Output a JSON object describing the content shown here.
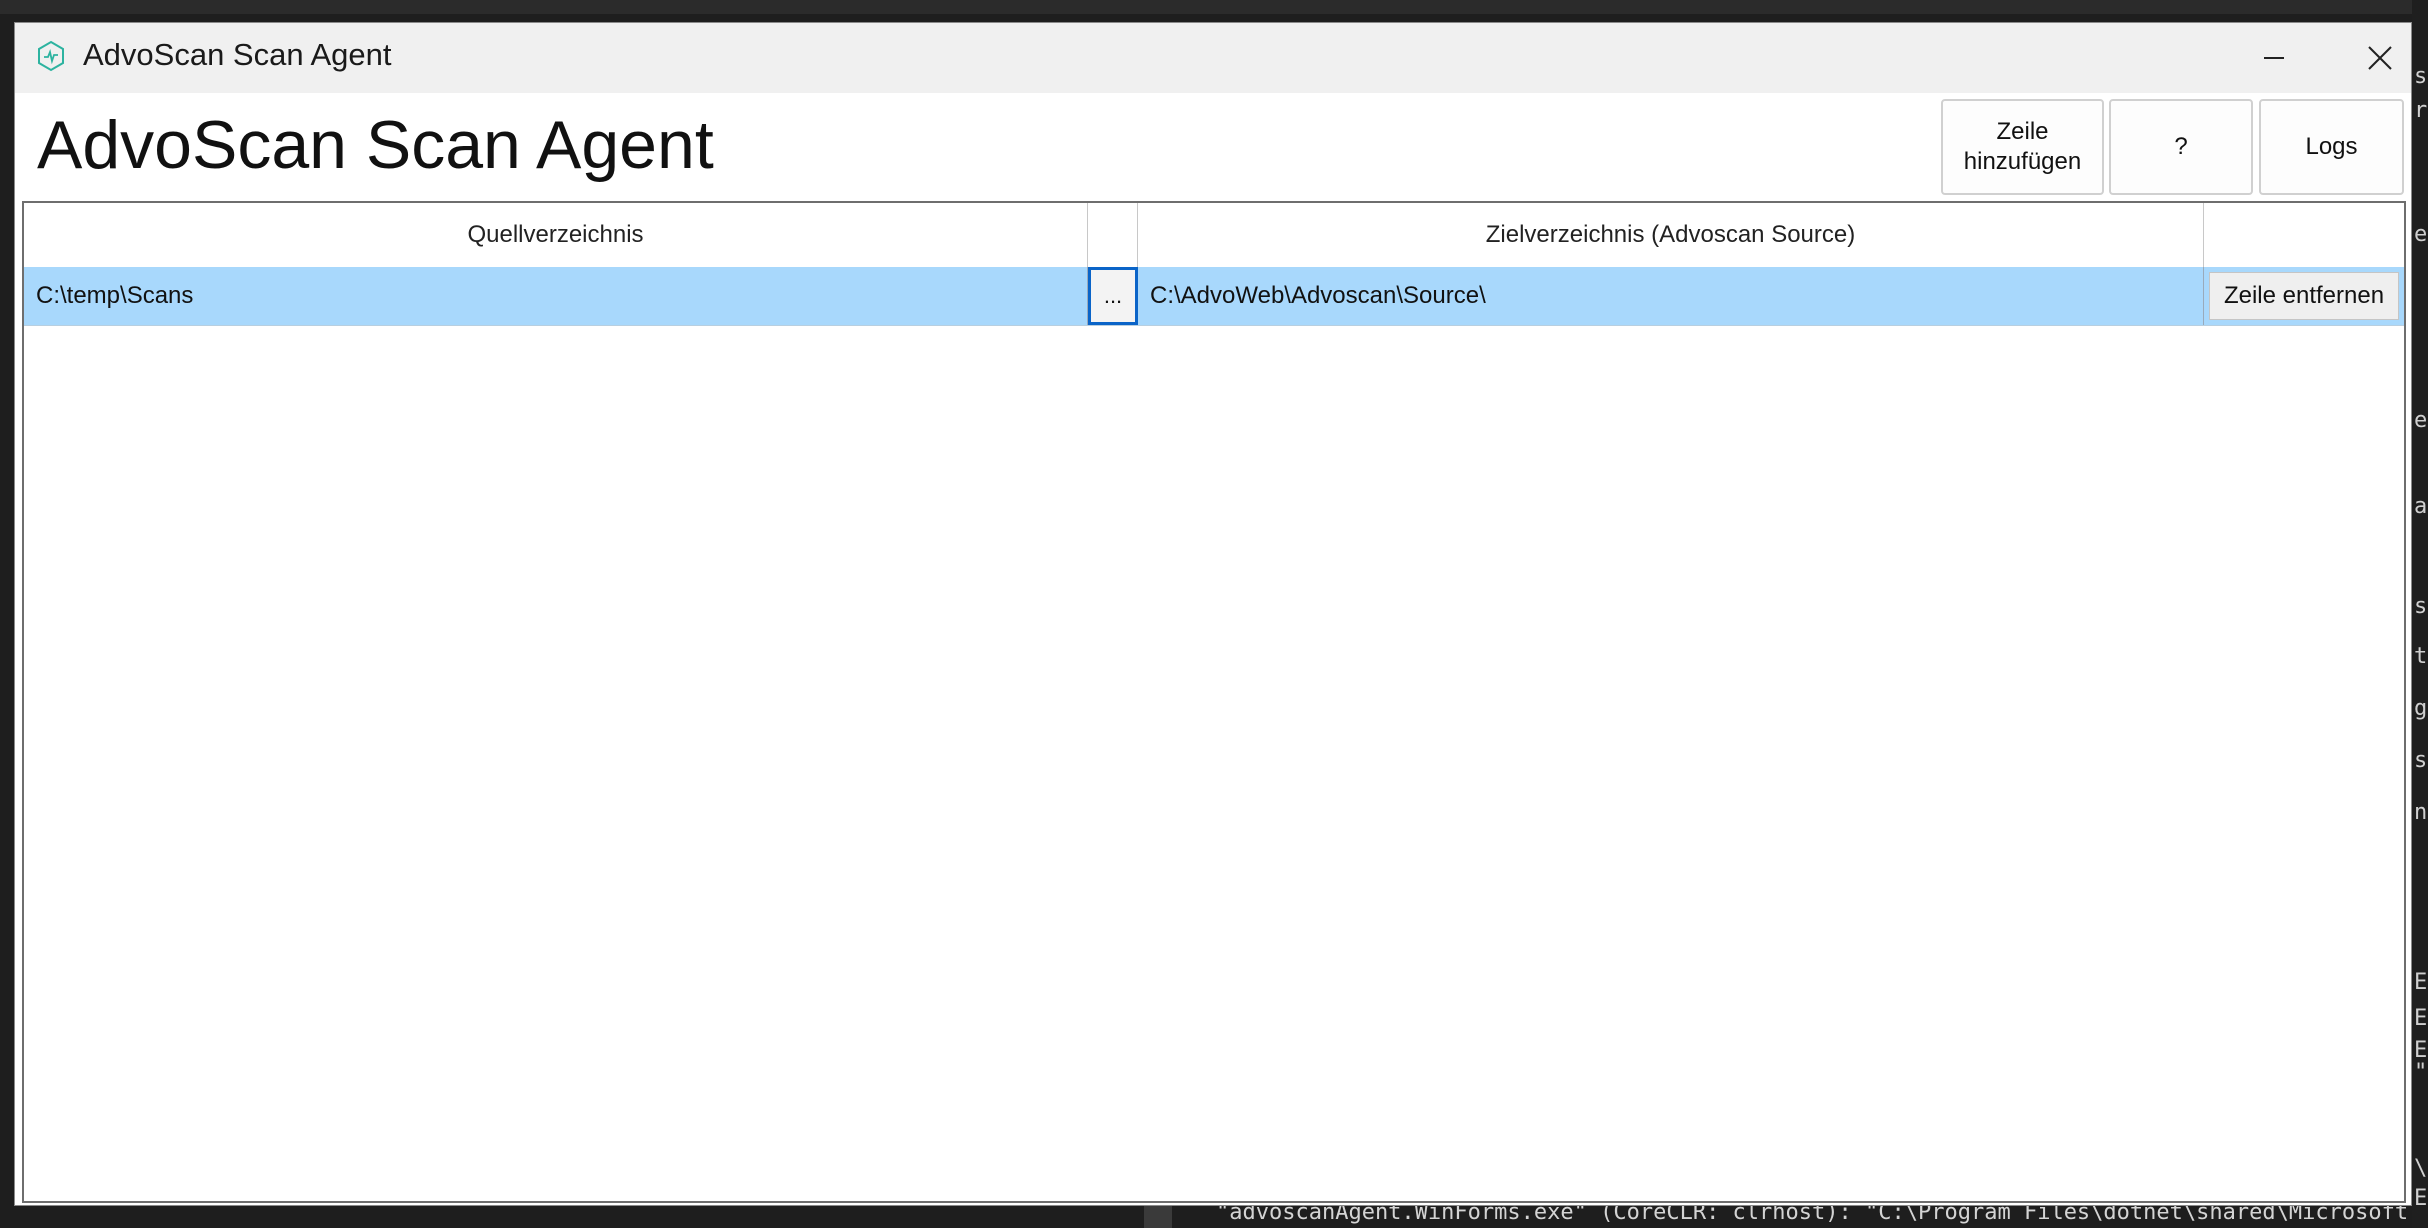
{
  "window": {
    "title": "AdvoScan Scan Agent",
    "icon": "app-logo-icon"
  },
  "heading": "AdvoScan Scan Agent",
  "toolbar": {
    "add_row_label": "Zeile\nhinzufügen",
    "help_label": "?",
    "logs_label": "Logs"
  },
  "grid": {
    "columns": [
      "Quellverzeichnis",
      "",
      "Zielverzeichnis (Advoscan Source)",
      ""
    ],
    "rows": [
      {
        "source": "C:\\temp\\Scans",
        "browse_label": "...",
        "target": "C:\\AdvoWeb\\Advoscan\\Source\\",
        "remove_label": "Zeile entfernen"
      }
    ]
  },
  "background": {
    "output_line": "\"advoscanAgent.WinForms.exe\" (CoreCLR: clrhost): \"C:\\Program Files\\dotnet\\shared\\Microsoft.NET",
    "right_fragments": [
      "st",
      "re",
      "ei",
      "e",
      "a",
      "ss",
      "to",
      "g",
      "sla",
      "nt",
      "E",
      "E",
      "E",
      "\"",
      "\\",
      "E"
    ]
  },
  "colors": {
    "selection": "#a8d8fc",
    "focus_border": "#0a64c8",
    "titlebar": "#f0f0f0"
  }
}
